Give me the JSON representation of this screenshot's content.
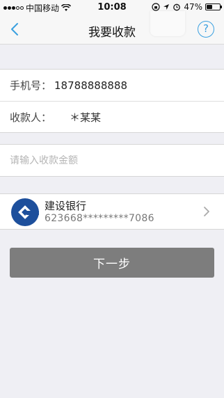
{
  "status_bar": {
    "carrier": "中国移动",
    "time": "10:08",
    "battery": "47%",
    "battery_level": 0.47,
    "icons": [
      "signal-dots-icon",
      "wifi-icon",
      "lock-rotation-icon",
      "location-arrow-icon",
      "alarm-icon",
      "battery-icon"
    ]
  },
  "nav": {
    "title": "我要收款",
    "back_icon": "chevron-left-icon",
    "help_glyph": "?"
  },
  "form": {
    "phone_label": "手机号：",
    "phone_value": "18788888888",
    "payee_label": "收款人：",
    "payee_value": "＊某某",
    "amount_placeholder": "请输入收款金额",
    "amount_value": ""
  },
  "bank": {
    "name": "建设银行",
    "card_number": "623668*********7086",
    "logo_color": "#1d4f9c"
  },
  "actions": {
    "next_label": "下一步"
  },
  "colors": {
    "accent": "#3aa0e0",
    "button_bg": "#7d7d7d",
    "page_bg": "#efeff4"
  }
}
